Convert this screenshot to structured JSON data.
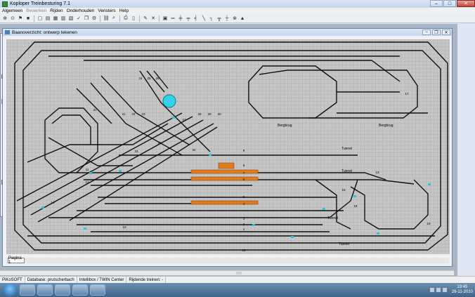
{
  "window": {
    "title": "Koploper Treinbesturing 7.1"
  },
  "menu": [
    {
      "label": "Algemeen",
      "enabled": true
    },
    {
      "label": "Bewerken",
      "enabled": false
    },
    {
      "label": "Rijden",
      "enabled": true
    },
    {
      "label": "Onderhouden",
      "enabled": true
    },
    {
      "label": "Vensters",
      "enabled": true
    },
    {
      "label": "Help",
      "enabled": true
    }
  ],
  "child_window": {
    "title": "Baanoverzicht: ontwerp tekenen"
  },
  "track": {
    "labels": [
      {
        "t": "24"
      },
      {
        "t": "25"
      },
      {
        "t": "26"
      },
      {
        "t": "21"
      },
      {
        "t": "22"
      },
      {
        "t": "23"
      },
      {
        "t": "31"
      },
      {
        "t": "27"
      },
      {
        "t": "28"
      },
      {
        "t": "29"
      },
      {
        "t": "30"
      },
      {
        "t": "20"
      },
      {
        "t": "33"
      },
      {
        "t": "32"
      },
      {
        "t": "11"
      },
      {
        "t": "12"
      },
      {
        "t": "13"
      },
      {
        "t": "9"
      },
      {
        "t": "8"
      },
      {
        "t": "7"
      },
      {
        "t": "6"
      },
      {
        "t": "5"
      },
      {
        "t": "4"
      },
      {
        "t": "3"
      },
      {
        "t": "2"
      },
      {
        "t": "1"
      },
      {
        "t": "14"
      },
      {
        "t": "10"
      },
      {
        "t": "15"
      },
      {
        "t": "16"
      },
      {
        "t": "17"
      },
      {
        "t": "18"
      },
      {
        "t": "19"
      }
    ],
    "texts": [
      {
        "t": "Bergbrug"
      },
      {
        "t": "Bergbrug"
      },
      {
        "t": "Tunnel"
      },
      {
        "t": "Tunnel"
      },
      {
        "t": "Tunnel"
      },
      {
        "t": "Tunnel"
      }
    ],
    "colors": {
      "grid_bg": "#c6c6c6",
      "grid_line": "#9a9a9a",
      "track": "#111111",
      "platform": "#e07b1e",
      "signal": "#2fd4e8",
      "turnout": "#22c8dc"
    }
  },
  "tab": {
    "label": "Pagina 1"
  },
  "status": [
    {
      "label": "PiKoSOFT"
    },
    {
      "label": "Database: prutscherbach"
    },
    {
      "label": "Intellibox / TWIN Center"
    },
    {
      "label": "Rijdende treinen: -"
    }
  ],
  "clock": {
    "time": "19:45",
    "date": "26-11-2010"
  }
}
